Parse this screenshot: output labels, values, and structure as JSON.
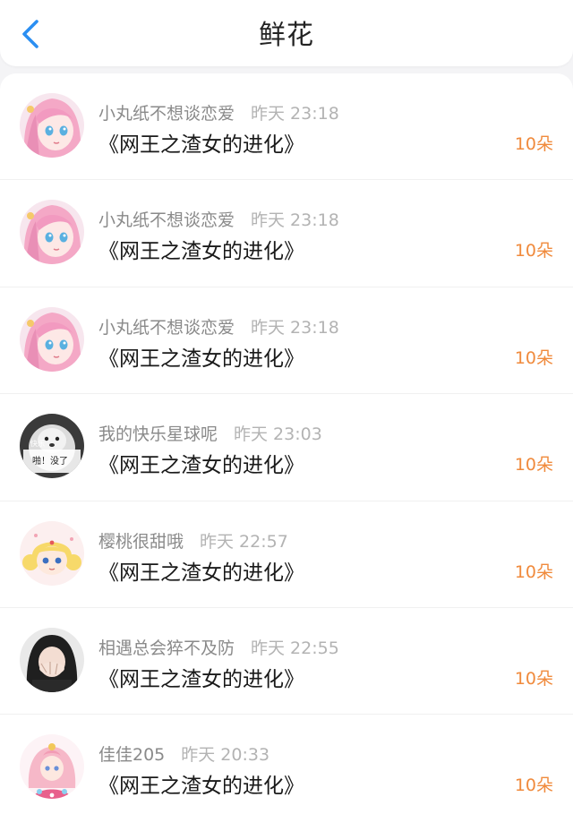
{
  "header": {
    "title": "鲜花",
    "back_icon": "chevron-left-icon",
    "back_color": "#2b8ff2"
  },
  "colors": {
    "count": "#f08a3c",
    "name": "#8a8a8a",
    "time": "#b3b3b3"
  },
  "items": [
    {
      "avatar": "anime-girl-pink",
      "name": "小丸纸不想谈恋爱",
      "time": "昨天 23:18",
      "book": "《网王之渣女的进化》",
      "count": "10朵"
    },
    {
      "avatar": "anime-girl-pink",
      "name": "小丸纸不想谈恋爱",
      "time": "昨天 23:18",
      "book": "《网王之渣女的进化》",
      "count": "10朵"
    },
    {
      "avatar": "anime-girl-pink",
      "name": "小丸纸不想谈恋爱",
      "time": "昨天 23:18",
      "book": "《网王之渣女的进化》",
      "count": "10朵"
    },
    {
      "avatar": "dog-meme",
      "avatar_text": [
        "快乐",
        "啪！没了"
      ],
      "name": "我的快乐星球呢",
      "time": "昨天 23:03",
      "book": "《网王之渣女的进化》",
      "count": "10朵"
    },
    {
      "avatar": "sailor-moon-chibi",
      "name": "樱桃很甜哦",
      "time": "昨天 22:57",
      "book": "《网王之渣女的进化》",
      "count": "10朵"
    },
    {
      "avatar": "girl-covering-face",
      "name": "相遇总会猝不及防",
      "time": "昨天 22:55",
      "book": "《网王之渣女的进化》",
      "count": "10朵"
    },
    {
      "avatar": "princess-doll",
      "name": "佳佳205",
      "time": "昨天 20:33",
      "book": "《网王之渣女的进化》",
      "count": "10朵"
    }
  ]
}
